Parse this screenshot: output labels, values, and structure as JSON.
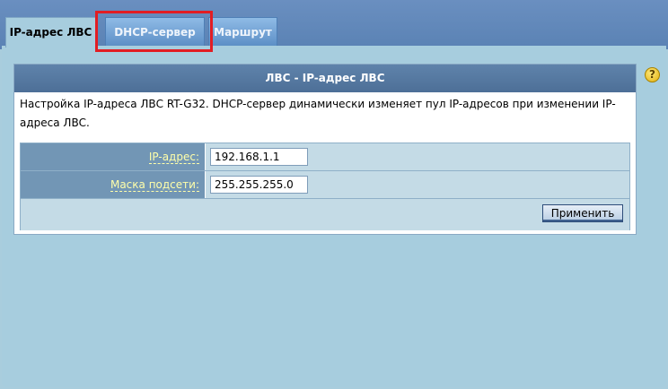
{
  "tabs": [
    {
      "label": "IP-адрес ЛВС",
      "active": true
    },
    {
      "label": "DHCP-сервер",
      "active": false
    },
    {
      "label": "Маршрут",
      "active": false
    }
  ],
  "help": {
    "glyph": "?"
  },
  "panel": {
    "title": "ЛВС - IP-адрес ЛВС",
    "description": "Настройка IP-адреса ЛВС RT-G32. DHCP-сервер динамически изменяет пул IP-адресов при изменении IP-адреса ЛВС."
  },
  "form": {
    "ip_label": "IP-адрес:",
    "ip_value": "192.168.1.1",
    "mask_label": "Маска подсети:",
    "mask_value": "255.255.255.0",
    "apply_label": "Применить"
  },
  "colors": {
    "highlight": "#e21d23",
    "header": "#4d6f97",
    "label_text": "#ffffaa"
  }
}
